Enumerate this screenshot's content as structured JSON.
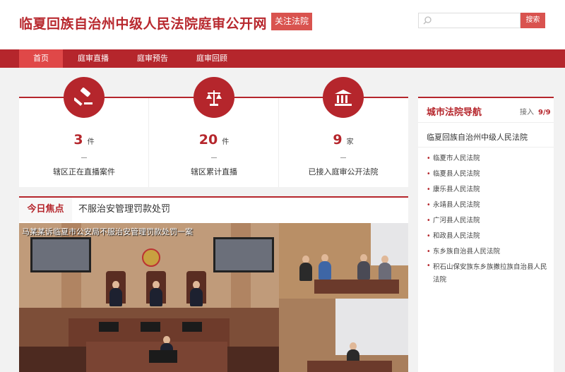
{
  "header": {
    "site_title": "临夏回族自治州中级人民法院庭审公开网",
    "follow_label": "关注法院",
    "search_placeholder": "",
    "search_label": "搜索"
  },
  "nav": {
    "items": [
      {
        "label": "首页",
        "active": true
      },
      {
        "label": "庭审直播",
        "active": false
      },
      {
        "label": "庭审预告",
        "active": false
      },
      {
        "label": "庭审回顾",
        "active": false
      }
    ]
  },
  "stats": [
    {
      "icon": "gavel-icon",
      "value": "3",
      "unit": "件",
      "label": "辖区正在直播案件"
    },
    {
      "icon": "scales-icon",
      "value": "20",
      "unit": "件",
      "label": "辖区累计直播"
    },
    {
      "icon": "courthouse-icon",
      "value": "9",
      "unit": "家",
      "label": "已接入庭审公开法院"
    }
  ],
  "focus": {
    "tag": "今日焦点",
    "title": "不服治安管理罚款处罚",
    "video_overlay": "马某某诉临夏市公安局不服治安管理罚款处罚一案"
  },
  "sidebar": {
    "title": "城市法院导航",
    "count_label": "接入",
    "count_value": "9/9",
    "main_court": "临夏回族自治州中级人民法院",
    "courts": [
      "临夏市人民法院",
      "临夏县人民法院",
      "康乐县人民法院",
      "永靖县人民法院",
      "广河县人民法院",
      "和政县人民法院",
      "东乡族自治县人民法院",
      "积石山保安族东乡族撒拉族自治县人民法院"
    ]
  },
  "colors": {
    "brand": "#b5262c",
    "accent": "#d9534f",
    "active_nav": "#e04848"
  }
}
